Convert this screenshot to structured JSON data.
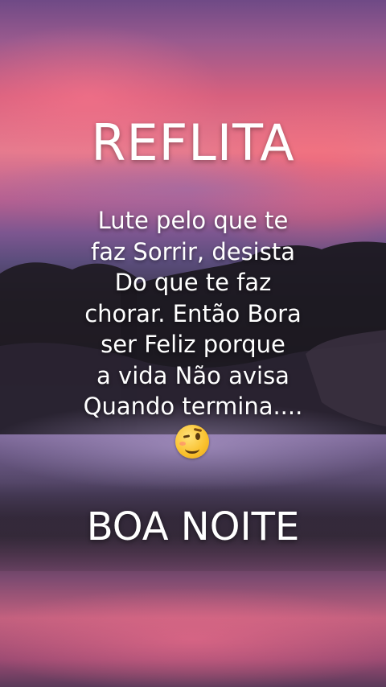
{
  "title": "REFLITA",
  "message_lines": [
    "Lute pelo que te",
    "faz Sorrir, desista",
    "Do que te faz",
    "chorar. Então Bora",
    "ser Feliz porque",
    "a vida Não avisa",
    "Quando termina...."
  ],
  "emoji": "winking-face",
  "closing": "BOA NOITE",
  "colors": {
    "text": "#ffffff",
    "sky_pink": "#e67b8e",
    "sky_purple": "#7c5690",
    "sea_lavender": "#8a74a6"
  }
}
